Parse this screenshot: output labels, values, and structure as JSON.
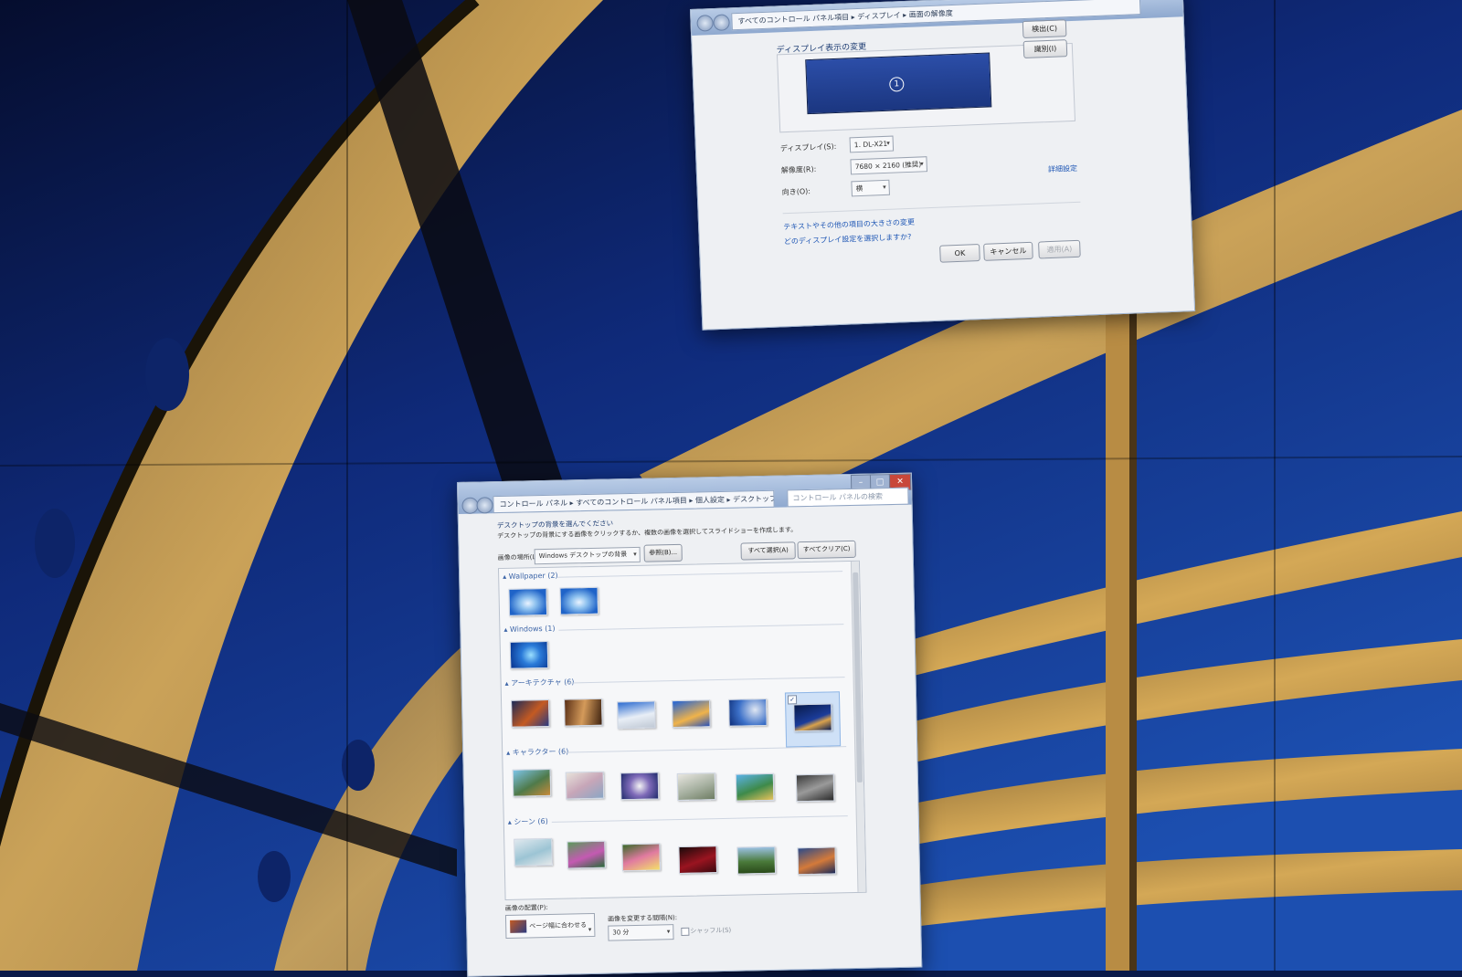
{
  "display_window": {
    "breadcrumb": [
      "すべてのコントロール パネル項目",
      "ディスプレイ",
      "画面の解像度"
    ],
    "heading": "ディスプレイ表示の変更",
    "detect_button": "検出(C)",
    "identify_button": "識別(I)",
    "monitor_number": "1",
    "display_label": "ディスプレイ(S):",
    "display_value": "1. DL-X21",
    "resolution_label": "解像度(R):",
    "resolution_value": "7680 × 2160 (推奨)",
    "orientation_label": "向き(O):",
    "orientation_value": "横",
    "advanced_link": "詳細設定",
    "text_size_link": "テキストやその他の項目の大きさの変更",
    "which_display_link": "どのディスプレイ設定を選択しますか?",
    "ok_button": "OK",
    "cancel_button": "キャンセル",
    "apply_button": "適用(A)"
  },
  "background_window": {
    "breadcrumb": [
      "コントロール パネル",
      "すべてのコントロール パネル項目",
      "個人設定",
      "デスクトップの背景"
    ],
    "search_placeholder": "コントロール パネルの検索",
    "heading": "デスクトップの背景を選んでください",
    "subtitle": "デスクトップの背景にする画像をクリックするか、複数の画像を選択してスライドショーを作成します。",
    "location_label": "画像の場所(L):",
    "location_value": "Windows デスクトップの背景",
    "browse_button": "参照(B)...",
    "select_all_button": "すべて選択(A)",
    "clear_all_button": "すべてクリア(C)",
    "groups": [
      {
        "title": "Wallpaper (2)"
      },
      {
        "title": "Windows (1)"
      },
      {
        "title": "アーキテクチャ (6)"
      },
      {
        "title": "キャラクター (6)"
      },
      {
        "title": "シーン (6)"
      }
    ],
    "position_label": "画像の配置(P):",
    "position_value": "ページ幅に合わせる",
    "interval_label": "画像を変更する間隔(N):",
    "interval_value": "30 分",
    "shuffle_label": "シャッフル(S)"
  },
  "colors": {
    "sky": "#12308a",
    "beam": "#c89a4a",
    "window_bg": "#eef0f3",
    "link": "#1f57b5"
  }
}
